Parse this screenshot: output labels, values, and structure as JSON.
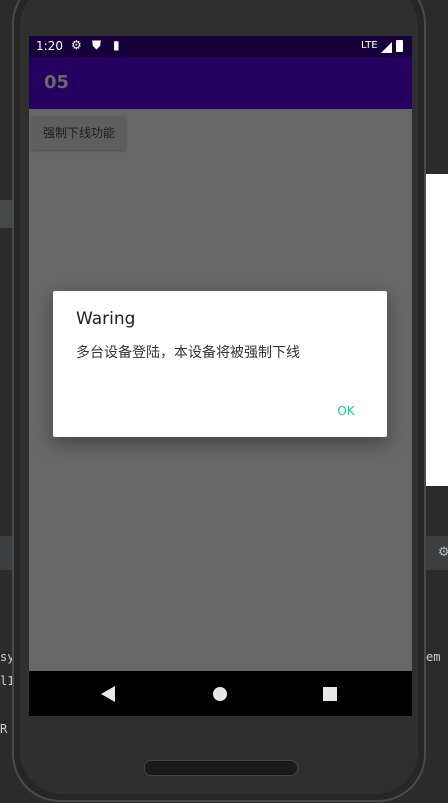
{
  "ide": {
    "line_left_1": "sy",
    "line_left_2": "l1",
    "line_left_3": "R",
    "line_right_1": "em",
    "gear_glyph": "⚙"
  },
  "status_bar": {
    "time": "1:20",
    "network": "LTE",
    "icons": [
      "gear-icon",
      "shield-icon",
      "sd-card-icon",
      "signal-icon",
      "battery-icon"
    ]
  },
  "app_bar": {
    "title": "05"
  },
  "main": {
    "force_offline_button": "强制下线功能"
  },
  "dialog": {
    "title": "Waring",
    "message": "多台设备登陆，本设备将被强制下线",
    "ok_label": "OK"
  },
  "colors": {
    "status_bar": "#17013b",
    "app_bar": "#250060",
    "dim_overlay": "#676767",
    "dialog_button": "#13c7b0"
  }
}
